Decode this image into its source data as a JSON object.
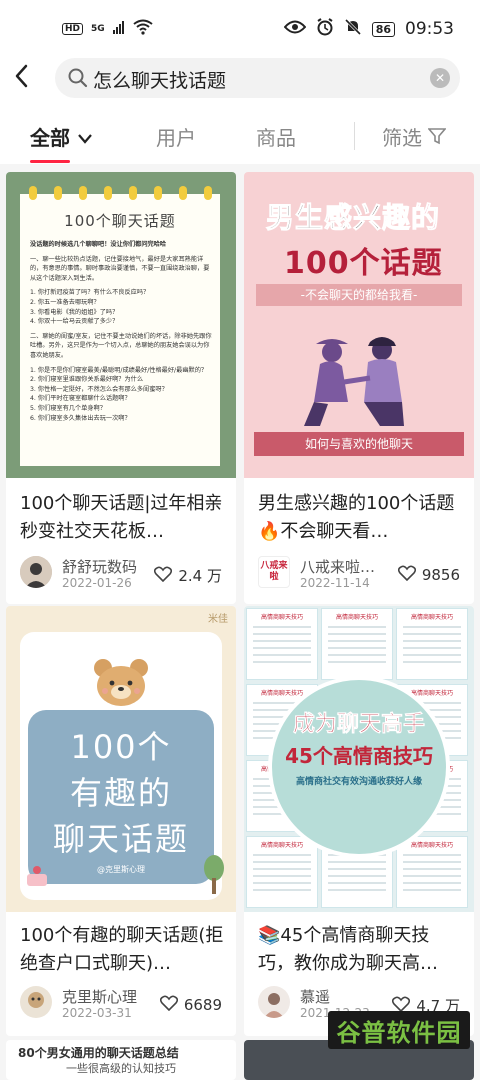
{
  "status": {
    "badge1": "HD",
    "badge2": "5G",
    "battery": "86",
    "time": "09:53"
  },
  "search": {
    "query": "怎么聊天找话题"
  },
  "tabs": {
    "all": "全部",
    "users": "用户",
    "goods": "商品",
    "filter": "筛选"
  },
  "cards": [
    {
      "cover_title": "100个聊天话题",
      "cover_lines": [
        "没话题的时候选几个聊聊吧！没让你们都问完哈哈",
        "一、聊一些比较热点话题，记住要接地气，最好是大家耳熟能详的，有意思的事情。聊时事政治要谨慎，不要一直围绕政治聊，要从这个话题深入到生活。",
        "1. 你打新冠疫苗了吗？有什么不良反应吗？",
        "2. 你五一准备去哪玩啊？",
        "3. 你看电影《我的姐姐》了吗？",
        "4. 你双十一给马云贡献了多少？",
        "二、聊她的闺蜜/室友，记住不要主动说她们的坏话，除非她先跟你吐槽。另外，这只是作为一个切入点，总聊她的朋友她会误以为你喜欢她朋友。",
        "1. 你是不是你们寝室最美/最聪明/成绩最好/性格最好/最幽默的？",
        "2. 你们寝室里谁跟你关系最好啊？为什么",
        "3. 你性格一定挺好，不然怎么会有那么多闺蜜呀？",
        "4. 你们平时在寝室都聊什么话题啊？",
        "5. 你们寝室有几个单身啊？",
        "6. 你们寝室多久集体出去玩一次啊？"
      ],
      "title": "100个聊天话题|过年相亲秒变社交天花板…",
      "user": "舒舒玩数码",
      "date": "2022-01-26",
      "likes": "2.4 万"
    },
    {
      "cover_title_1a": "男生感兴趣",
      "cover_title_1b": "的",
      "cover_title_2": "100个话题",
      "cover_sub": "-不会聊天的都给我看-",
      "cover_bar": "如何与喜欢的他聊天",
      "title": "男生感兴趣的100个话题🔥不会聊天看…",
      "user": "八戒来啦…",
      "avatar_text": "八戒来啦",
      "date": "2022-11-14",
      "likes": "9856"
    },
    {
      "cover_line1": "100个",
      "cover_line2": "有趣的",
      "cover_line3": "聊天话题",
      "cover_tag": "米佳",
      "cover_small": "@克里斯心理",
      "title": "100个有趣的聊天话题(拒绝查户口式聊天)…",
      "user": "克里斯心理",
      "date": "2022-03-31",
      "likes": "6689"
    },
    {
      "cover_line1": "成为聊天高手",
      "cover_line2": "45个高情商技巧",
      "cover_line3": "高情商社交有效沟通收获好人缘",
      "cover_panel": "高情商聊天技巧",
      "title": "📚45个高情商聊天技巧，教你成为聊天高…",
      "user": "慕遥",
      "date": "2021-12-23",
      "likes": "4.7 万"
    }
  ],
  "peek": {
    "line1": "80个男女通用的聊天话题总结",
    "line2": "一些很高级的认知技巧"
  },
  "watermark": "谷普软件园",
  "colors": {
    "accent": "#ff2442"
  }
}
